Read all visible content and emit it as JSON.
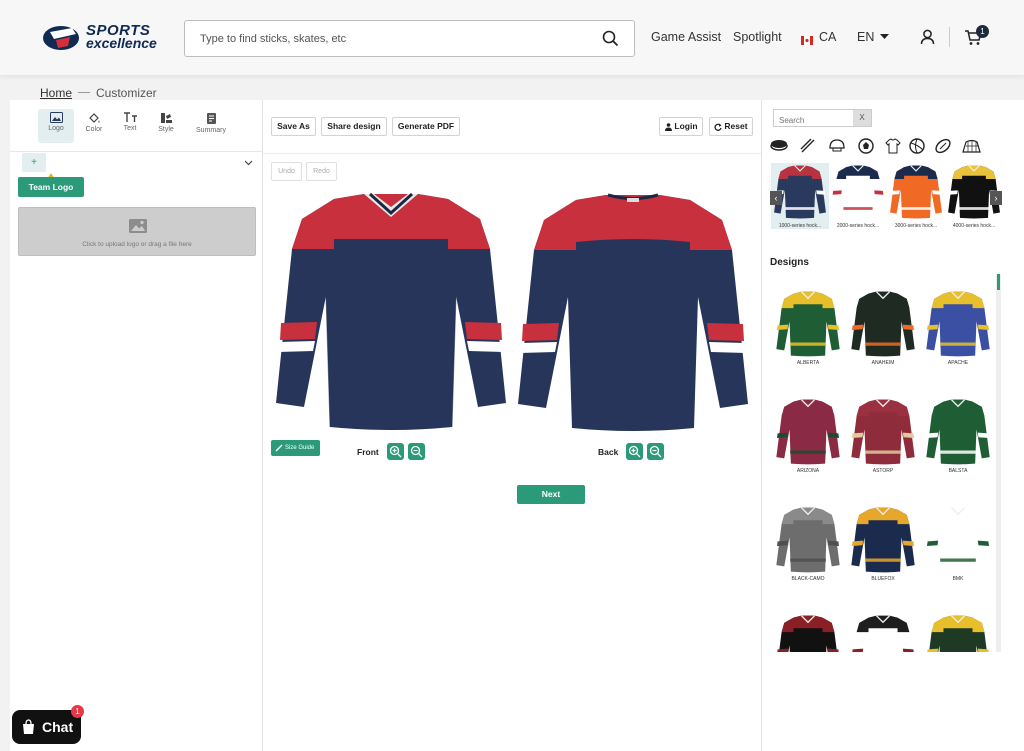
{
  "header": {
    "brand_line1": "SPORTS",
    "brand_line2": "excellence",
    "search_placeholder": "Type to find sticks, skates, etc",
    "nav": [
      "Game Assist",
      "Spotlight"
    ],
    "country": "CA",
    "language": "EN",
    "cart_count": "1"
  },
  "breadcrumb": {
    "home": "Home",
    "current": "Customizer"
  },
  "left": {
    "tabs": [
      "Logo",
      "Color",
      "Text",
      "Style",
      "Summary"
    ],
    "add_label": "+",
    "team_logo": "Team Logo",
    "upload_text": "Click to upload logo or drag a file here"
  },
  "mid": {
    "save_as": "Save As",
    "share": "Share design",
    "pdf": "Generate PDF",
    "login": "Login",
    "reset": "Reset",
    "undo": "Undo",
    "redo": "Redo",
    "size_guide": "Size Guide",
    "front": "Front",
    "back": "Back",
    "next": "Next"
  },
  "right": {
    "search_placeholder": "Search",
    "clear": "X",
    "categories": [
      "hockey-puck-icon",
      "hockey-sticks-icon",
      "helmet-icon",
      "soccer-ball-icon",
      "tshirt-icon",
      "volleyball-icon",
      "football-icon",
      "hockey-net-icon"
    ],
    "products": [
      {
        "label": "1000-series hock...",
        "body": "#2a3a5e",
        "yoke": "#b8323f",
        "stripe": "#ffffff"
      },
      {
        "label": "2000-series hock...",
        "body": "#ffffff",
        "yoke": "#1b2b4d",
        "stripe": "#c5313f"
      },
      {
        "label": "3000-series hock...",
        "body": "#f06a26",
        "yoke": "#1b2b4d",
        "stripe": "#ffffff"
      },
      {
        "label": "4000-series hock...",
        "body": "#111111",
        "yoke": "#e9c13a",
        "stripe": "#ffffff"
      }
    ],
    "designs_title": "Designs",
    "designs": [
      {
        "name": "ALBERTA",
        "body": "#1f5e34",
        "yoke": "#e7bf2b",
        "stripe": "#e7bf2b"
      },
      {
        "name": "ANAHEIM",
        "body": "#1e2a22",
        "yoke": "#1e2a22",
        "stripe": "#f06a26"
      },
      {
        "name": "APACHE",
        "body": "#3b4fa3",
        "yoke": "#e7bf2b",
        "stripe": "#e7bf2b"
      },
      {
        "name": "ARIZONA",
        "body": "#8a2a44",
        "yoke": "#8a2a44",
        "stripe": "#1f4a2f"
      },
      {
        "name": "ASTORP",
        "body": "#8f2c3c",
        "yoke": "#9b3140",
        "stripe": "#e3c99b"
      },
      {
        "name": "BALSTA",
        "body": "#1f5e34",
        "yoke": "#1f5e34",
        "stripe": "#ffffff"
      },
      {
        "name": "BLACK-CAMO",
        "body": "#6d6d6d",
        "yoke": "#8a8a8a",
        "stripe": "#4f4f4f"
      },
      {
        "name": "BLUEFOX",
        "body": "#1b2b4d",
        "yoke": "#e7a72b",
        "stripe": "#e7a72b"
      },
      {
        "name": "BMK",
        "body": "#ffffff",
        "yoke": "#ffffff",
        "stripe": "#1f5e34"
      },
      {
        "name": "",
        "body": "#111111",
        "yoke": "#8a2026",
        "stripe": "#8a2026"
      },
      {
        "name": "",
        "body": "#ffffff",
        "yoke": "#1e1e1e",
        "stripe": "#8a2026"
      },
      {
        "name": "",
        "body": "#1e3a24",
        "yoke": "#e7bf2b",
        "stripe": "#e7bf2b"
      }
    ]
  },
  "chat": {
    "label": "Chat",
    "badge": "1"
  }
}
